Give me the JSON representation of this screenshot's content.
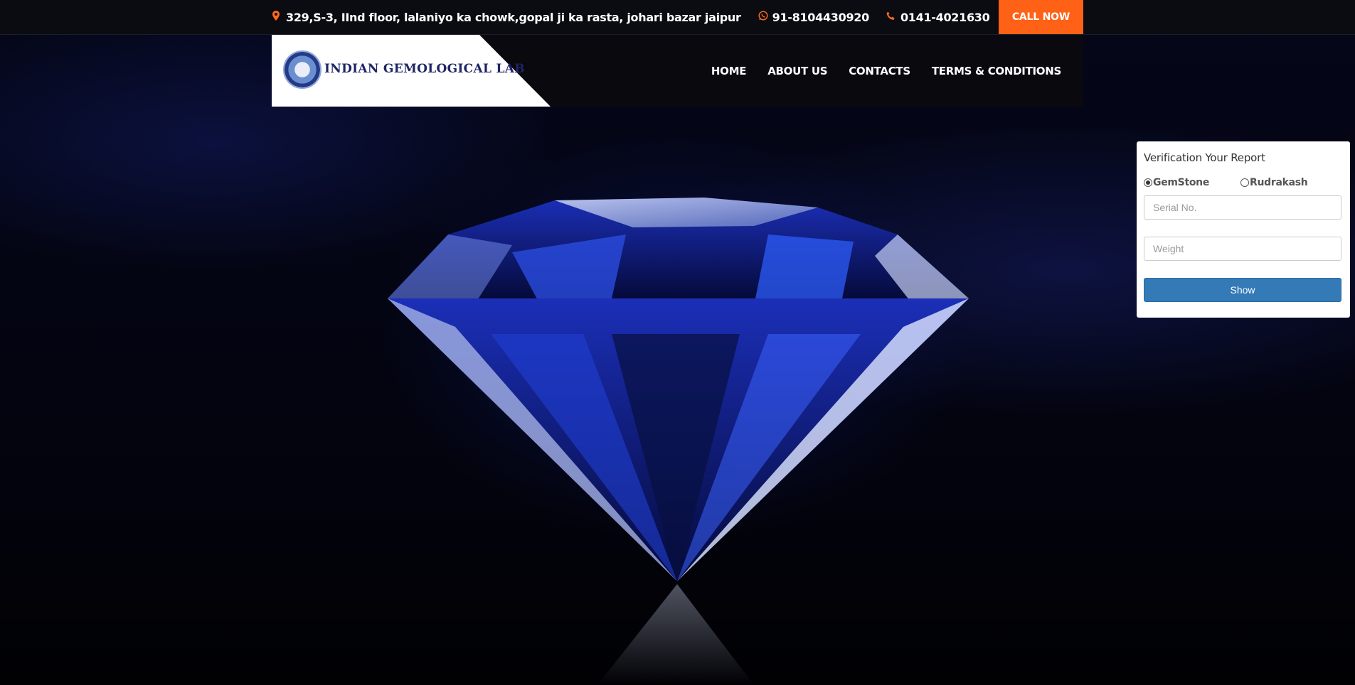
{
  "topbar": {
    "address": "329,S-3, IInd floor, lalaniyo ka chowk,gopal ji ka rasta, johari bazar jaipur",
    "whatsapp": "91-8104430920",
    "phone": "0141-4021630",
    "call_now": "CALL NOW",
    "address_icon": "map-marker-icon",
    "whatsapp_icon": "whatsapp-icon",
    "phone_icon": "phone-icon"
  },
  "logo": {
    "text": "INDIAN GEMOLOGICAL LAB"
  },
  "nav": {
    "items": [
      {
        "label": "HOME"
      },
      {
        "label": "ABOUT US"
      },
      {
        "label": "CONTACTS"
      },
      {
        "label": "TERMS & CONDITIONS"
      }
    ]
  },
  "verification": {
    "title": "Verification Your Report",
    "options": [
      {
        "label": "GemStone",
        "selected": true
      },
      {
        "label": "Rudrakash",
        "selected": false
      }
    ],
    "serial_placeholder": "Serial No.",
    "weight_placeholder": "Weight",
    "submit_label": "Show"
  },
  "colors": {
    "accent": "#ff6116",
    "button_blue": "#337ab7",
    "topbar_bg": "#0b0c11"
  }
}
